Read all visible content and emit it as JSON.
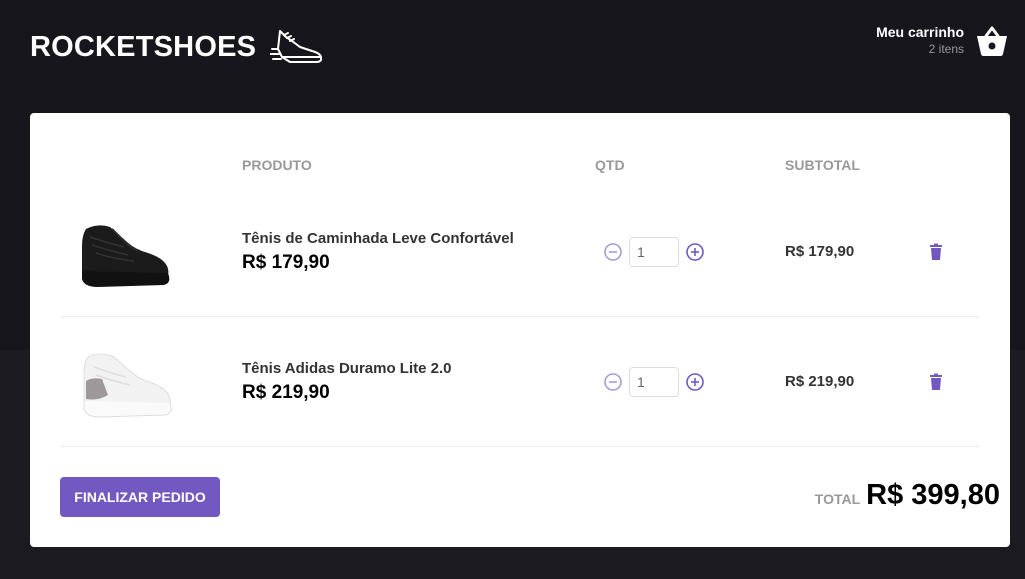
{
  "header": {
    "logo_text": "ROCKETSHOES",
    "logo_icon": "sneaker-icon",
    "cart": {
      "title": "Meu carrinho",
      "count": "2 itens",
      "icon": "basket-icon"
    }
  },
  "table": {
    "headers": {
      "product": "PRODUTO",
      "qty": "QTD",
      "subtotal": "SUBTOTAL"
    },
    "items": [
      {
        "title": "Tênis de Caminhada Leve Confortável",
        "price": "R$ 179,90",
        "qty": "1",
        "subtotal": "R$ 179,90",
        "image": "black-sneaker-image"
      },
      {
        "title": "Tênis Adidas Duramo Lite 2.0",
        "price": "R$ 219,90",
        "qty": "1",
        "subtotal": "R$ 219,90",
        "image": "white-sneaker-image"
      }
    ]
  },
  "footer": {
    "checkout_label": "Finalizar pedido",
    "total_label": "TOTAL",
    "total_value": "R$ 399,80"
  },
  "colors": {
    "brand": "#7159c1",
    "background": "#17161c"
  }
}
